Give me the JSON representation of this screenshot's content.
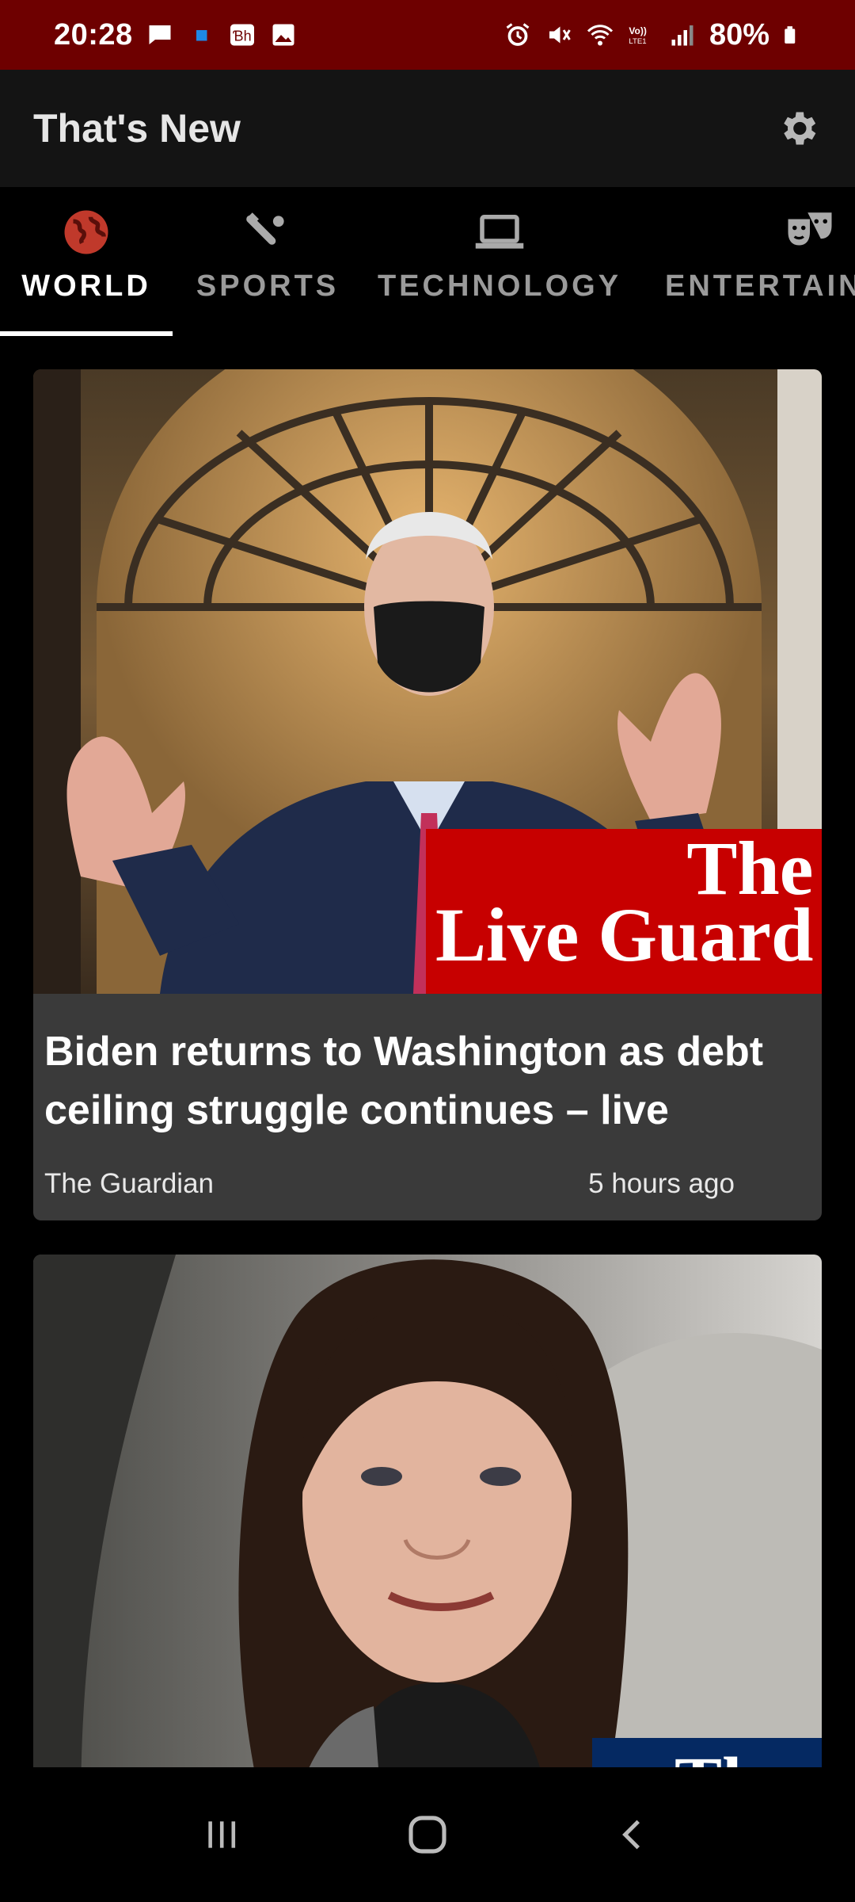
{
  "status_bar": {
    "time": "20:28",
    "battery": "80%",
    "left_icons": [
      "chat-icon",
      "notification-dot-icon",
      "app-badge-icon",
      "gallery-icon"
    ],
    "right_icons": [
      "alarm-icon",
      "mute-icon",
      "wifi-icon",
      "volte-icon",
      "signal-icon",
      "battery-icon"
    ],
    "background": "#6e0000"
  },
  "app_bar": {
    "title": "That's New",
    "settings_icon": "gear-icon"
  },
  "tabs": [
    {
      "label": "WORLD",
      "icon": "globe-icon",
      "active": true,
      "icon_color": "#c0392b"
    },
    {
      "label": "SPORTS",
      "icon": "sports-icon",
      "active": false
    },
    {
      "label": "TECHNOLOGY",
      "icon": "laptop-icon",
      "active": false
    },
    {
      "label": "ENTERTAIN",
      "icon": "theater-masks-icon",
      "active": false
    }
  ],
  "articles": [
    {
      "title": "Biden returns to Washington as debt ceiling struggle continues – live",
      "source": "The Guardian",
      "time": "5 hours ago",
      "image_badge": {
        "line1": "The",
        "line2": "Live Guard"
      }
    },
    {
      "title": "",
      "source": "",
      "time": "",
      "image_badge": {
        "line1": "The"
      }
    }
  ],
  "nav_bar": {
    "items": [
      "recent-apps-icon",
      "home-icon",
      "back-icon"
    ]
  }
}
